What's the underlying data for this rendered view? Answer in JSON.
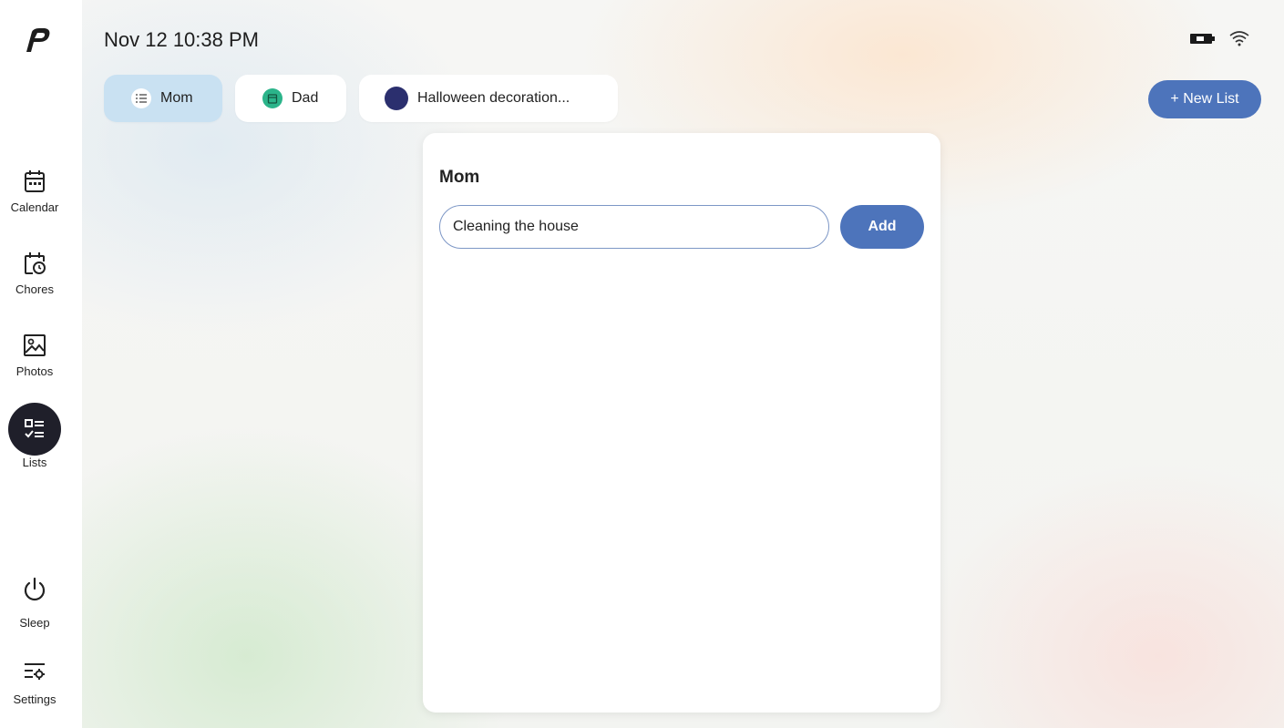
{
  "header": {
    "datetime": "Nov 12 10:38 PM"
  },
  "sidebar": {
    "items": [
      {
        "label": "Calendar",
        "icon": "calendar-icon"
      },
      {
        "label": "Chores",
        "icon": "chores-icon"
      },
      {
        "label": "Photos",
        "icon": "photos-icon"
      },
      {
        "label": "Lists",
        "icon": "lists-icon",
        "active": true
      },
      {
        "label": "Sleep",
        "icon": "power-icon"
      },
      {
        "label": "Settings",
        "icon": "settings-icon"
      }
    ]
  },
  "tabs": [
    {
      "label": "Mom",
      "icon": "list-icon",
      "active": true
    },
    {
      "label": "Dad",
      "icon": "calendar-icon",
      "color": "#2bb48a"
    },
    {
      "label": "Halloween decoration...",
      "color": "#2b2f6e"
    }
  ],
  "new_list_label": "+ New List",
  "card": {
    "title": "Mom",
    "input_value": "Cleaning the house",
    "add_label": "Add"
  },
  "colors": {
    "accent": "#4d74bb",
    "active_tab": "#c9e1f2",
    "active_nav": "#1f1f2a"
  }
}
